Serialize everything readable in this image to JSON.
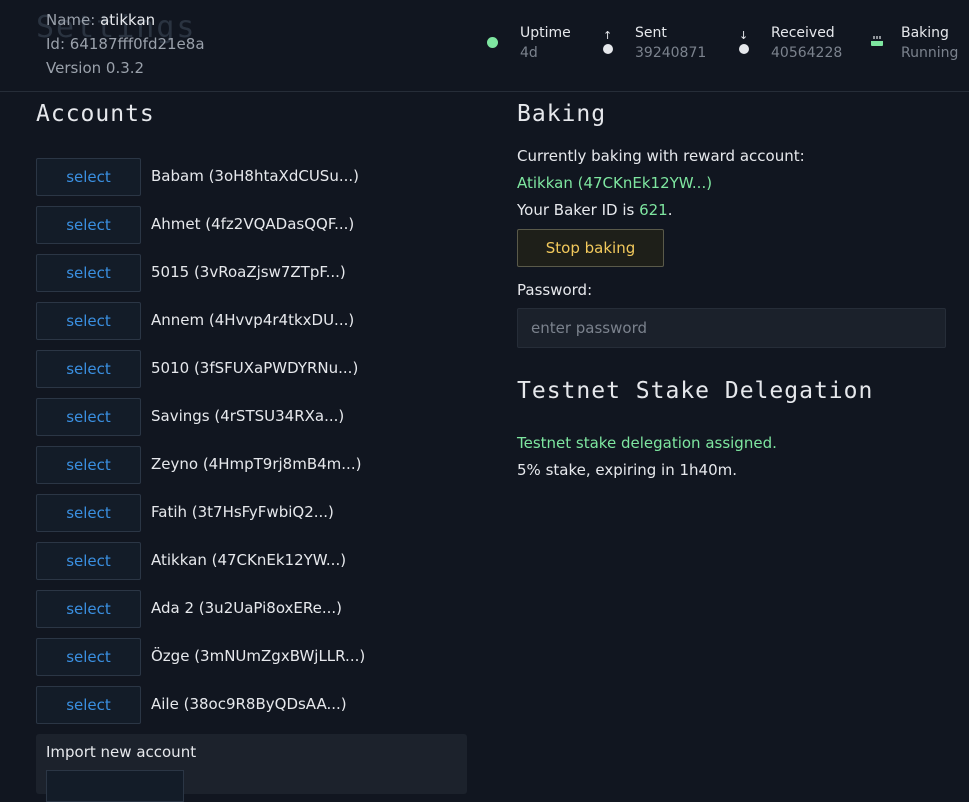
{
  "header": {
    "ghost_title": "Settings",
    "name_label": "Name:",
    "name_value": "atikkan",
    "id_label": "Id:",
    "id_value": "64187fff0fd21e8a",
    "version": "Version 0.3.2",
    "stats": {
      "uptime": {
        "label": "Uptime",
        "value": "4d",
        "color": "#7ee6a0"
      },
      "sent": {
        "label": "Sent",
        "value": "39240871",
        "arrow": "↑"
      },
      "received": {
        "label": "Received",
        "value": "40564228",
        "arrow": "↓"
      },
      "baking": {
        "label": "Baking",
        "value": "Running",
        "icon": "baking-icon"
      }
    }
  },
  "accounts": {
    "title": "Accounts",
    "select_label": "select",
    "items": [
      "Babam (3oH8htaXdCUSu...)",
      "Ahmet (4fz2VQADasQQF...)",
      "5015 (3vRoaZjsw7ZTpF...)",
      "Annem (4Hvvp4r4tkxDU...)",
      "5010 (3fSFUXaPWDYRNu...)",
      "Savings (4rSTSU34RXa...)",
      "Zeyno (4HmpT9rj8mB4m...)",
      "Fatih (3t7HsFyFwbiQ2...)",
      "Atikkan (47CKnEk12YW...)",
      "Ada 2 (3u2UaPi8oxERe...)",
      "Özge (3mNUmZgxBWjLLR...)",
      "Aile (38oc9R8ByQDsAA...)"
    ],
    "import_title": "Import new account"
  },
  "baking": {
    "title": "Baking",
    "currently_text": "Currently baking with reward account:",
    "reward_account": "Atikkan (47CKnEk12YW...)",
    "baker_id_prefix": "Your Baker ID is ",
    "baker_id": "621",
    "baker_id_suffix": ".",
    "stop_label": "Stop baking",
    "password_label": "Password:",
    "password_placeholder": "enter password"
  },
  "delegation": {
    "title": "Testnet Stake Delegation",
    "status": "Testnet stake delegation assigned.",
    "detail": "5% stake, expiring in 1h40m."
  },
  "colors": {
    "accent_green": "#7ee6a0",
    "select_blue": "#3a8fe0",
    "stop_yellow": "#f2c95c"
  }
}
